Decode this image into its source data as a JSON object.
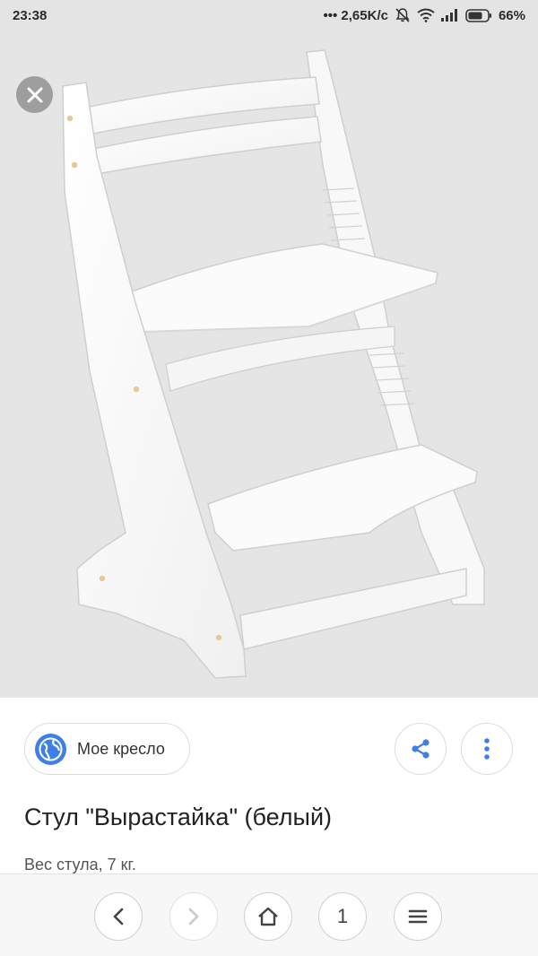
{
  "status_bar": {
    "time": "23:38",
    "network_speed": "••• 2,65K/c",
    "battery_percent": "66%",
    "icons": [
      "mute-bell-icon",
      "wifi-icon",
      "signal-icon",
      "battery-icon"
    ]
  },
  "viewer": {
    "image_subject": "white adjustable wooden chair",
    "close_icon": "close-icon"
  },
  "result": {
    "source_name": "Мое кресло",
    "title": "Стул \"Вырастайка\" (белый)",
    "snippet": "Вес стула, 7 кг."
  },
  "actions": {
    "share_icon": "share-icon",
    "more_icon": "more-vertical-icon"
  },
  "browser_nav": {
    "tab_count": "1",
    "back_icon": "chevron-left-icon",
    "forward_icon": "chevron-right-icon",
    "home_icon": "home-icon",
    "menu_icon": "menu-icon"
  },
  "colors": {
    "accent": "#3f7fe8",
    "image_background": "#e5e5e5",
    "status_bar": "#e4e4e4"
  }
}
